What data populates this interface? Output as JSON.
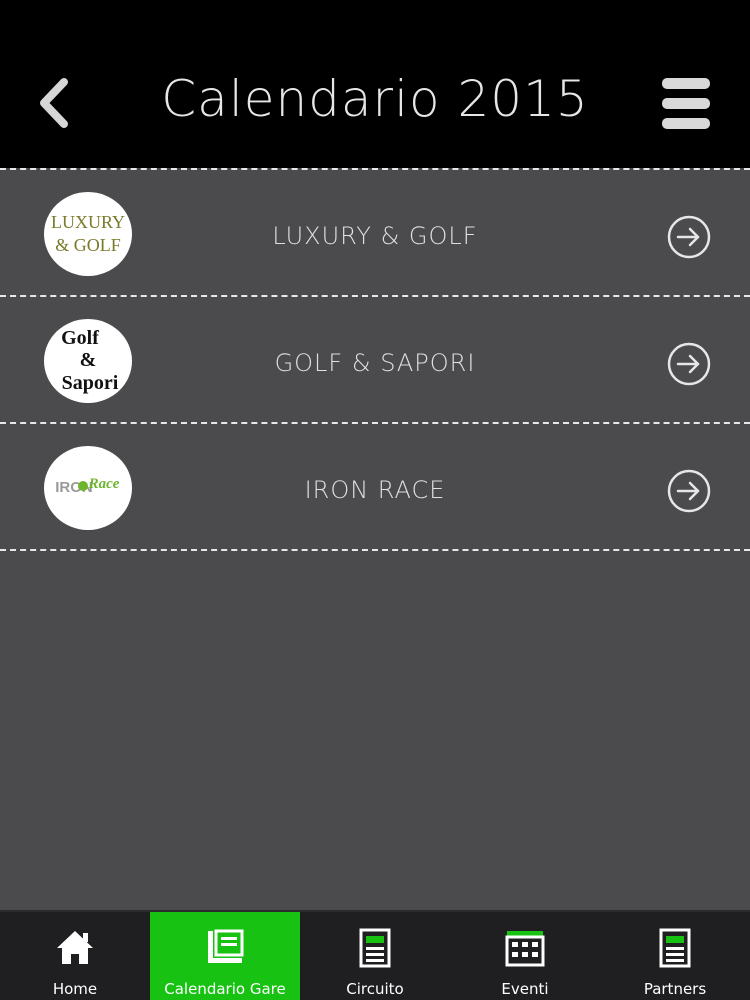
{
  "header": {
    "title": "Calendario 2015",
    "back_icon": "chevron-left-icon",
    "menu_icon": "hamburger-menu-icon"
  },
  "events": [
    {
      "label": "LUXURY & GOLF",
      "logo_text": [
        "LUXURY",
        "& GOLF"
      ]
    },
    {
      "label": "GOLF & SAPORI",
      "logo_text": [
        "Golf",
        "&",
        "Sapori"
      ]
    },
    {
      "label": "IRON RACE",
      "logo_text": [
        "IRON",
        "Race"
      ]
    }
  ],
  "tabs": [
    {
      "label": "Home",
      "icon": "home-icon",
      "active": false
    },
    {
      "label": "Calendario Gare",
      "icon": "calendar-book-icon",
      "active": true
    },
    {
      "label": "Circuito",
      "icon": "document-icon",
      "active": false
    },
    {
      "label": "Eventi",
      "icon": "calendar-grid-icon",
      "active": false
    },
    {
      "label": "Partners",
      "icon": "document-icon",
      "active": false
    }
  ],
  "colors": {
    "header_bg": "#000000",
    "body_bg": "#4b4a4c",
    "accent_green": "#17c212",
    "tabbar_bg": "#1f1f21"
  }
}
